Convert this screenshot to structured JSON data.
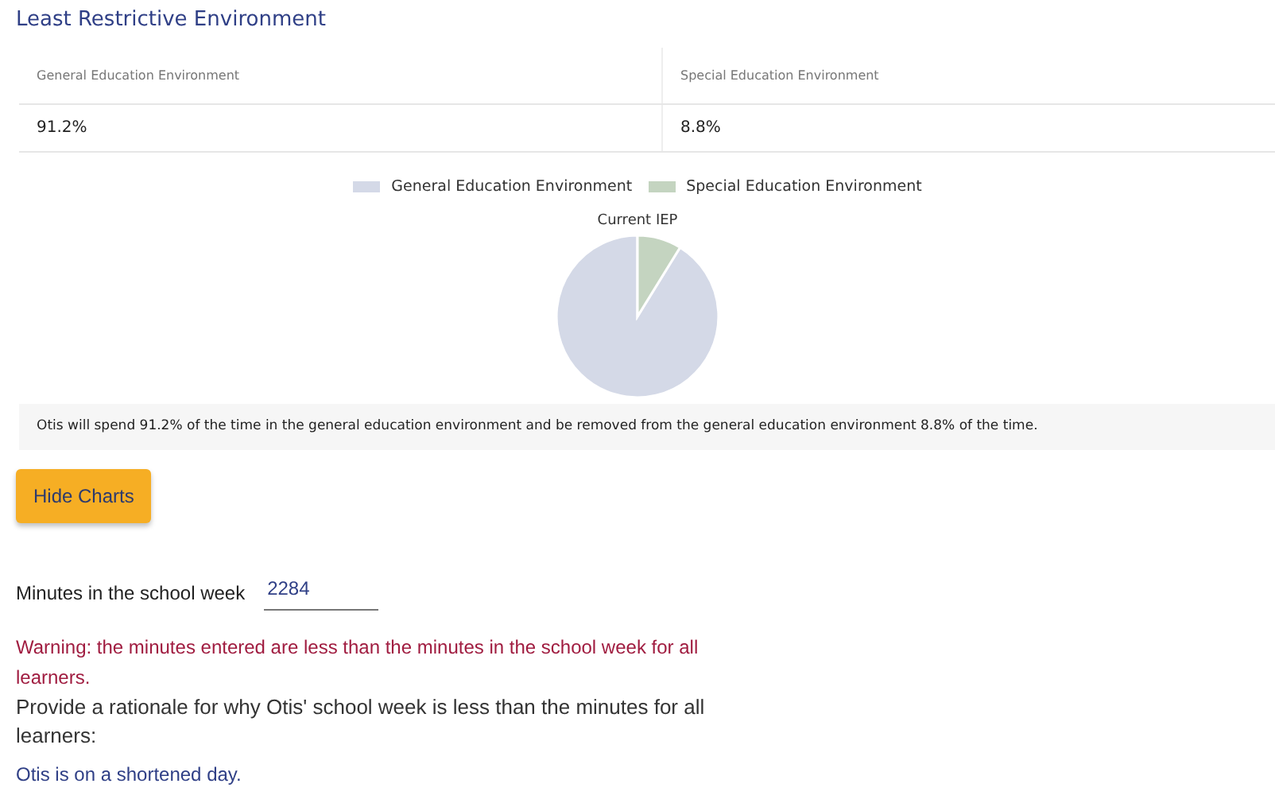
{
  "section_title": "Least Restrictive Environment",
  "table": {
    "columns": [
      "General Education Environment",
      "Special Education Environment"
    ],
    "rows": [
      [
        "91.2%",
        "8.8%"
      ]
    ]
  },
  "chart": {
    "chart_data": {
      "type": "pie",
      "legend": "top",
      "categories": [
        "General Education Environment",
        "Special Education Environment"
      ],
      "series": [
        {
          "name": "Current IEP",
          "values": [
            91.2,
            8.8
          ]
        }
      ],
      "colors": [
        "#d4d9e7",
        "#c4d4c0"
      ]
    }
  },
  "summary": "Otis will spend 91.2% of the time in the general education environment and be removed from the general education environment 8.8% of the time.",
  "hide_charts_button": "Hide Charts",
  "minutes": {
    "label": "Minutes in the school week",
    "value": "2284"
  },
  "warning": "Warning: the minutes entered are less than the minutes in the school week for all learners.",
  "rationale": {
    "label": "Provide a rationale for why Otis' school week is less than the minutes for all learners:",
    "value": "Otis is on a shortened day."
  }
}
